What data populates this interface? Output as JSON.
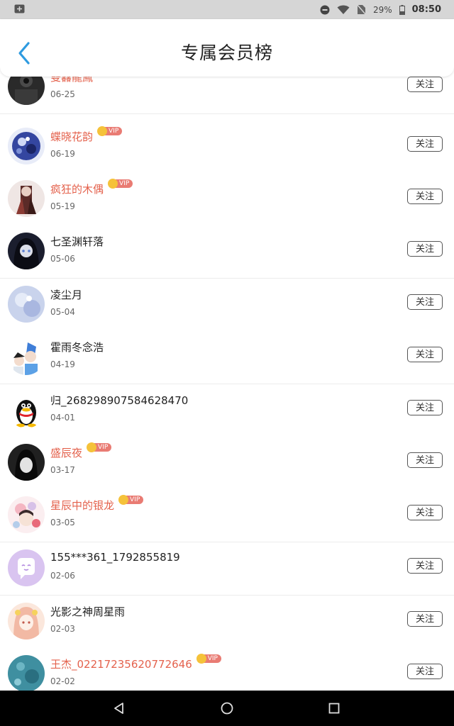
{
  "status_bar": {
    "notification_icon": "notification-square-icon",
    "battery_percent": "29%",
    "time": "08:50"
  },
  "header": {
    "title": "专属会员榜",
    "back_icon": "chevron-left-icon"
  },
  "colors": {
    "vip_name": "#e4624d",
    "accent_blue": "#2e9be0",
    "vip_crown": "#f5c23a",
    "vip_tag": "#e97b73"
  },
  "members": [
    {
      "name": "雙馫龍鳳",
      "date": "06-25",
      "vip": true,
      "follow": "关注"
    },
    {
      "name": "蝶晓花韵",
      "date": "06-19",
      "vip": true,
      "follow": "关注"
    },
    {
      "name": "疯狂的木偶",
      "date": "05-19",
      "vip": true,
      "follow": "关注"
    },
    {
      "name": "七圣渊轩落",
      "date": "05-06",
      "vip": false,
      "follow": "关注"
    },
    {
      "name": "凌尘月",
      "date": "05-04",
      "vip": false,
      "follow": "关注"
    },
    {
      "name": "霍雨冬念浩",
      "date": "04-19",
      "vip": false,
      "follow": "关注"
    },
    {
      "name": "归_268298907584628470",
      "date": "04-01",
      "vip": false,
      "follow": "关注"
    },
    {
      "name": "盛辰夜",
      "date": "03-17",
      "vip": true,
      "follow": "关注"
    },
    {
      "name": "星辰中的银龙",
      "date": "03-05",
      "vip": true,
      "follow": "关注"
    },
    {
      "name": "155***361_1792855819",
      "date": "02-06",
      "vip": false,
      "follow": "关注"
    },
    {
      "name": "光影之神周星雨",
      "date": "02-03",
      "vip": false,
      "follow": "关注"
    },
    {
      "name": "王杰_02217235620772646",
      "date": "02-02",
      "vip": true,
      "follow": "关注"
    }
  ],
  "vip_label": "VIP",
  "nav_bar": {
    "back": "triangle-back-icon",
    "home": "circle-home-icon",
    "recents": "square-recents-icon"
  }
}
